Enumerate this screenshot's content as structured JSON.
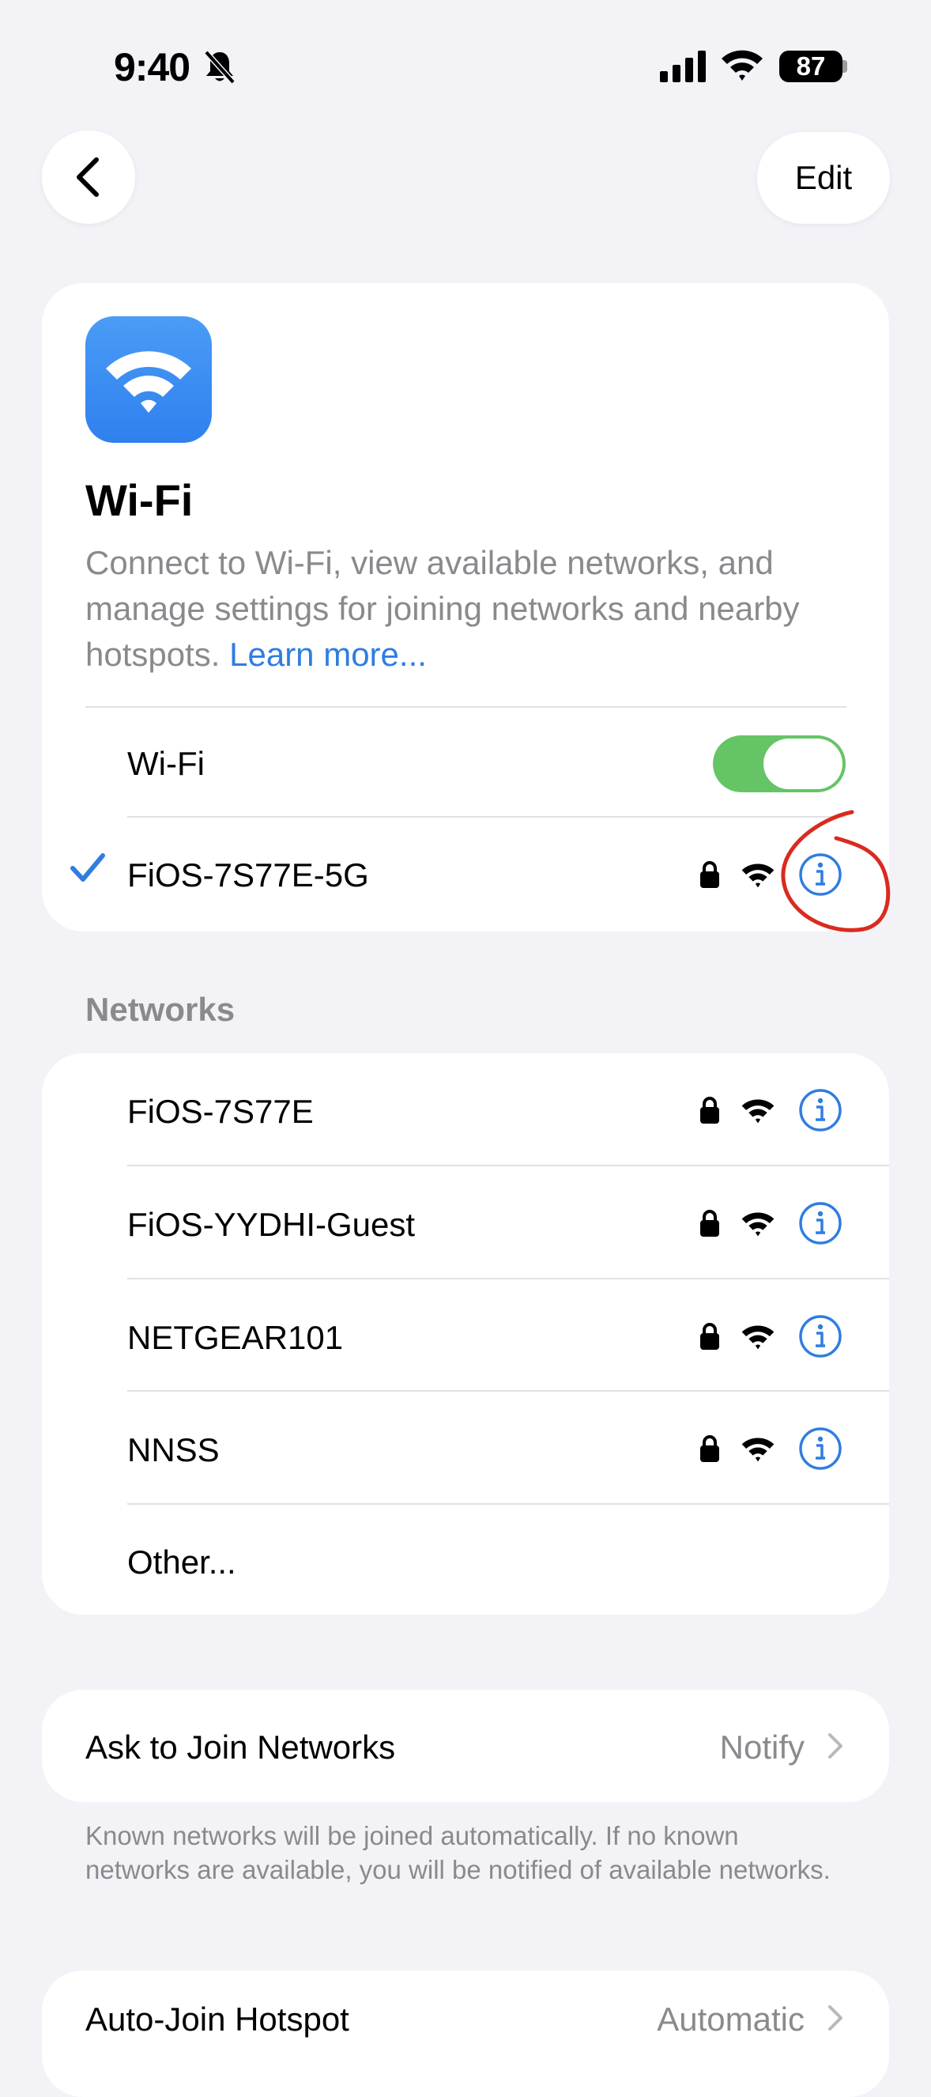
{
  "status_bar": {
    "time": "9:40",
    "battery": "87"
  },
  "nav": {
    "edit_label": "Edit"
  },
  "header": {
    "title": "Wi-Fi",
    "description": "Connect to Wi-Fi, view available networks, and manage settings for joining networks and nearby hotspots.",
    "learn_more": "Learn more..."
  },
  "wifi_toggle": {
    "label": "Wi-Fi",
    "on": true
  },
  "connected_network": {
    "name": "FiOS-7S77E-5G"
  },
  "networks": {
    "header": "Networks",
    "items": [
      {
        "name": "FiOS-7S77E"
      },
      {
        "name": "FiOS-YYDHI-Guest"
      },
      {
        "name": "NETGEAR101"
      },
      {
        "name": "NNSS"
      }
    ],
    "other": "Other..."
  },
  "ask_to_join": {
    "label": "Ask to Join Networks",
    "value": "Notify",
    "footnote": "Known networks will be joined automatically. If no known networks are available, you will be notified of available networks."
  },
  "auto_join": {
    "label": "Auto-Join Hotspot",
    "value": "Automatic"
  },
  "colors": {
    "background": "#f2f2f7",
    "accent": "#2f7de1",
    "toggle_on": "#65c466",
    "annotation": "#d92b1f"
  },
  "icons": [
    "back-chevron-icon",
    "bell-slash-icon",
    "signal-icon",
    "wifi-icon",
    "lock-icon",
    "info-icon",
    "checkmark-icon",
    "chevron-right-icon"
  ]
}
